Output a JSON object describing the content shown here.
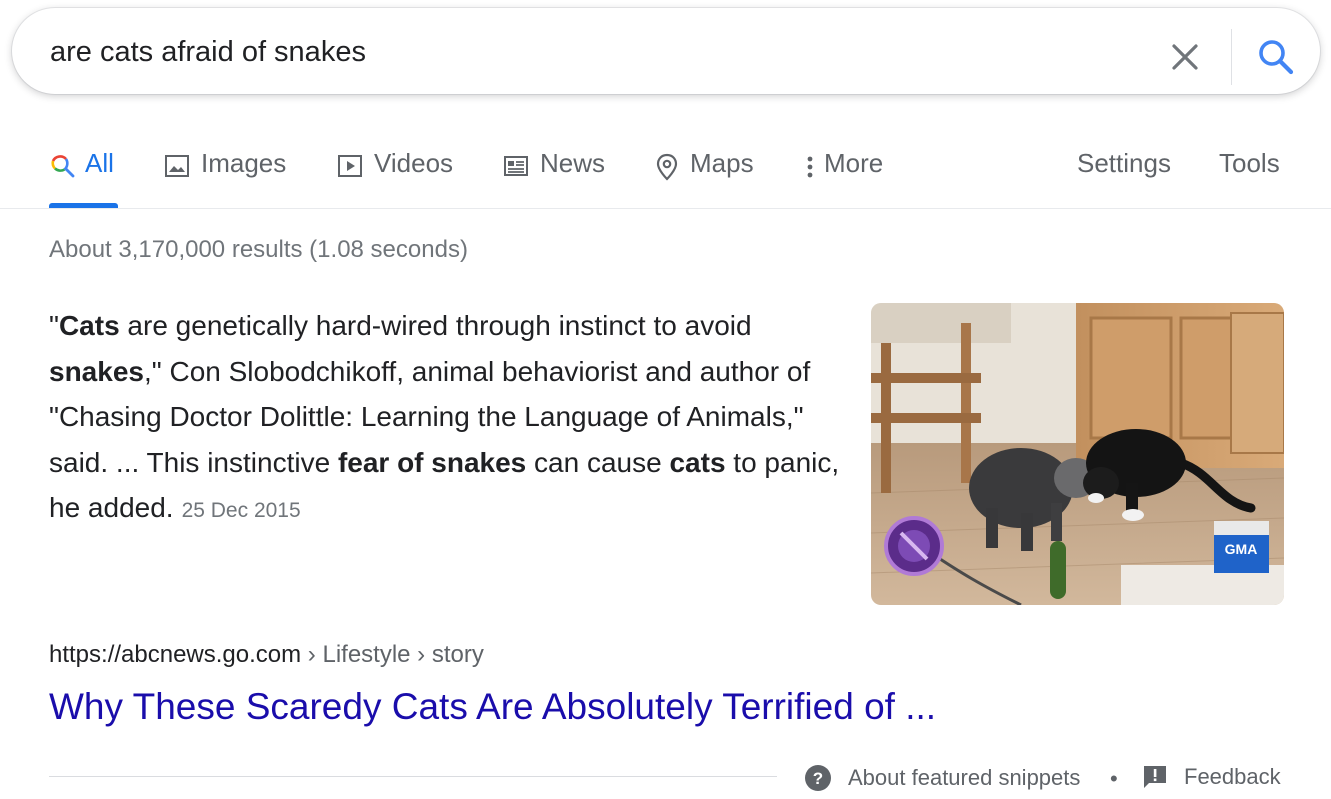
{
  "search": {
    "query": "are cats afraid of snakes",
    "clear_icon": "close-icon",
    "search_icon": "search-icon"
  },
  "tabs": [
    {
      "label": "All",
      "icon": "search-icon",
      "active": true
    },
    {
      "label": "Images",
      "icon": "image-icon"
    },
    {
      "label": "Videos",
      "icon": "play-icon"
    },
    {
      "label": "News",
      "icon": "newspaper-icon"
    },
    {
      "label": "Maps",
      "icon": "map-pin-icon"
    },
    {
      "label": "More",
      "icon": "more-vert-icon"
    }
  ],
  "tools": {
    "settings": "Settings",
    "tools": "Tools"
  },
  "results_stats": "About 3,170,000 results (1.08 seconds)",
  "featured_snippet": {
    "parts": [
      {
        "text": "\"",
        "bold": false
      },
      {
        "text": "Cats",
        "bold": true
      },
      {
        "text": " are genetically hard-wired through instinct to avoid ",
        "bold": false
      },
      {
        "text": "snakes",
        "bold": true
      },
      {
        "text": ",\" Con Slobodchikoff, animal behaviorist and author of \"Chasing Doctor Dolittle: Learning the Language of Animals,\" said. ... This instinctive ",
        "bold": false
      },
      {
        "text": "fear of snakes",
        "bold": true
      },
      {
        "text": " can cause ",
        "bold": false
      },
      {
        "text": "cats",
        "bold": true
      },
      {
        "text": " to panic, he added.",
        "bold": false
      }
    ],
    "date": "25 Dec 2015",
    "image_badges": [
      "GMA"
    ]
  },
  "result": {
    "url": "https://abcnews.go.com",
    "breadcrumbs": " › Lifestyle › story",
    "title": "Why These Scaredy Cats Are Absolutely Terrified of ..."
  },
  "footer": {
    "about": "About featured snippets",
    "separator": "•",
    "feedback": "Feedback"
  },
  "colors": {
    "accent": "#1a73e8",
    "link": "#1a0dab",
    "muted": "#70757a"
  }
}
